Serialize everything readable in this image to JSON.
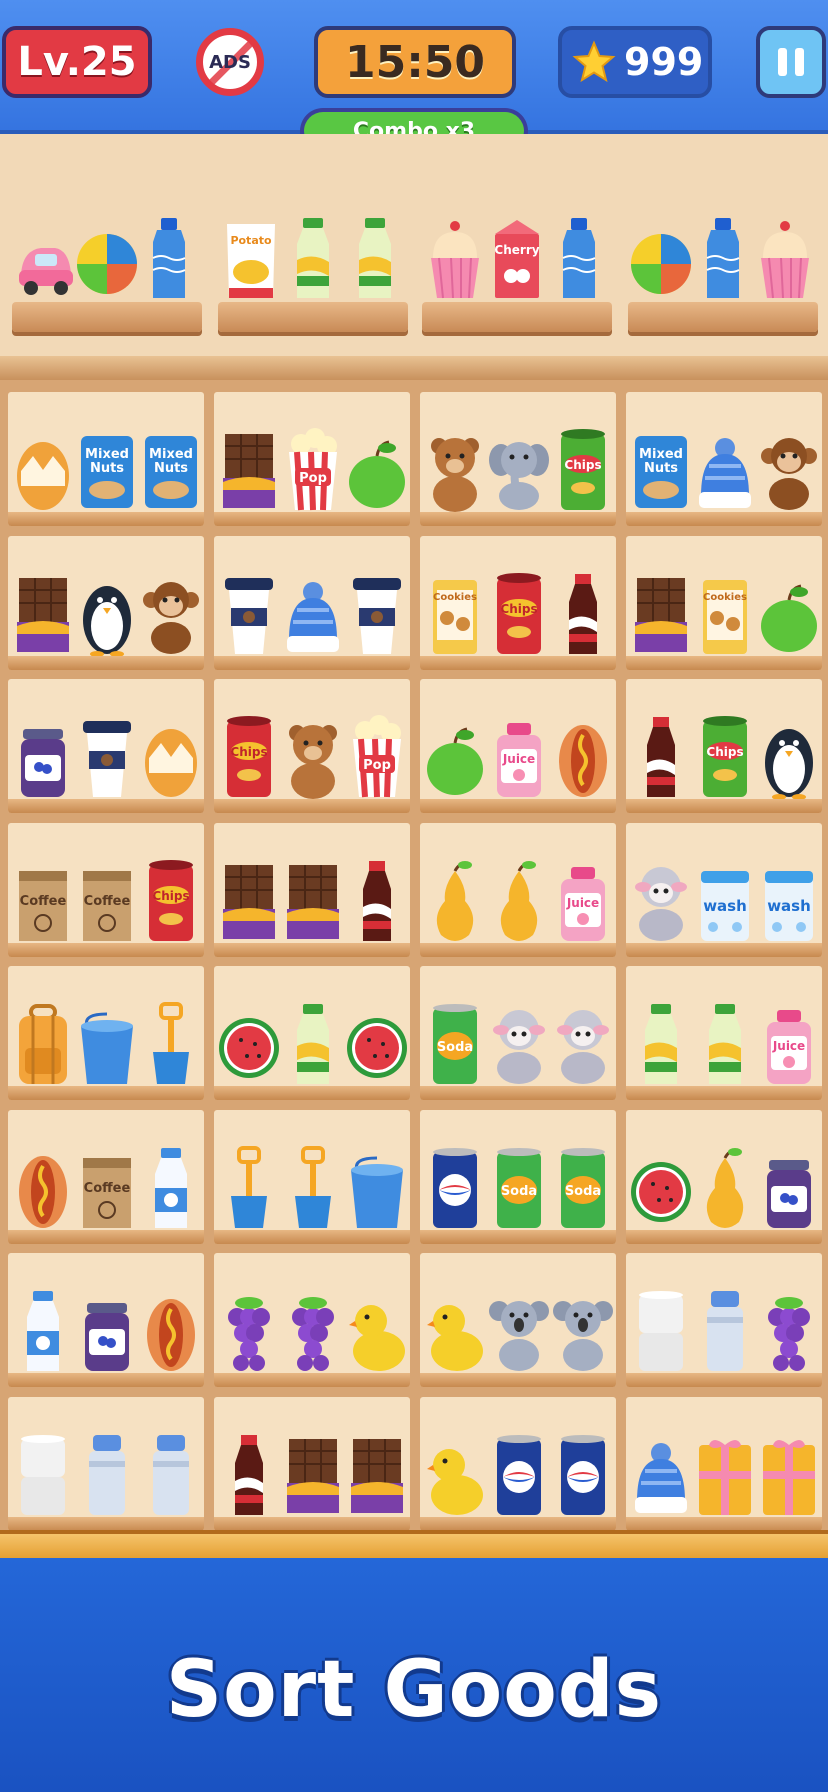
{
  "hud": {
    "level": "Lv.25",
    "ads": "ADS",
    "timer": "15:50",
    "stars": "999",
    "combo": "Combo x3"
  },
  "top_shelves": [
    [
      "car-icon",
      "beach-ball-icon",
      "water-bottle-icon"
    ],
    [
      "potato-chips-bag-icon",
      "juice-bottle-icon",
      "juice-bottle-icon"
    ],
    [
      "cupcake-icon",
      "cherry-carton-icon",
      "water-bottle-icon"
    ],
    [
      "beach-ball-icon",
      "water-bottle-icon",
      "cupcake-icon"
    ]
  ],
  "grid": [
    [
      [
        "egg-icon",
        "mixed-nuts-icon",
        "mixed-nuts-icon"
      ],
      [
        "chocolate-bar-icon",
        "popcorn-icon",
        "green-apple-icon"
      ],
      [
        "teddy-bear-icon",
        "elephant-icon",
        "chips-can-green-icon"
      ],
      [
        "mixed-nuts-icon",
        "beanie-hat-icon",
        "monkey-icon"
      ]
    ],
    [
      [
        "chocolate-bar-icon",
        "penguin-icon",
        "monkey-icon"
      ],
      [
        "coffee-cup-icon",
        "beanie-hat-icon",
        "coffee-cup-icon"
      ],
      [
        "cookies-box-icon",
        "chips-can-red-icon",
        "cola-bottle-icon"
      ],
      [
        "chocolate-bar-icon",
        "cookies-box-icon",
        "green-apple-icon"
      ]
    ],
    [
      [
        "jam-jar-icon",
        "coffee-cup-icon",
        "egg-icon"
      ],
      [
        "chips-can-red-icon",
        "teddy-bear-icon",
        "popcorn-icon"
      ],
      [
        "green-apple-icon",
        "juice-jug-icon",
        "hot-dog-icon"
      ],
      [
        "cola-bottle-icon",
        "chips-can-green-icon",
        "penguin-icon"
      ]
    ],
    [
      [
        "coffee-bag-icon",
        "coffee-bag-icon",
        "chips-can-red-icon"
      ],
      [
        "chocolate-bar-icon",
        "chocolate-bar-icon",
        "cola-bottle-icon"
      ],
      [
        "pear-icon",
        "pear-icon",
        "juice-jug-icon"
      ],
      [
        "sheep-icon",
        "detergent-icon",
        "detergent-icon"
      ]
    ],
    [
      [
        "backpack-icon",
        "bucket-icon",
        "shovel-icon"
      ],
      [
        "watermelon-icon",
        "juice-bottle-icon",
        "watermelon-icon"
      ],
      [
        "soda-can-icon",
        "sheep-icon",
        "sheep-icon"
      ],
      [
        "juice-bottle-icon",
        "juice-bottle-icon",
        "juice-jug-icon"
      ]
    ],
    [
      [
        "hot-dog-icon",
        "coffee-bag-icon",
        "milk-bottle-icon"
      ],
      [
        "shovel-icon",
        "shovel-icon",
        "bucket-icon"
      ],
      [
        "pepsi-can-icon",
        "soda-can-icon",
        "soda-can-icon"
      ],
      [
        "watermelon-icon",
        "pear-icon",
        "jam-jar-icon"
      ]
    ],
    [
      [
        "milk-bottle-icon",
        "jam-jar-icon",
        "hot-dog-icon"
      ],
      [
        "grapes-icon",
        "grapes-icon",
        "rubber-duck-icon"
      ],
      [
        "rubber-duck-icon",
        "koala-icon",
        "koala-icon"
      ],
      [
        "toilet-paper-icon",
        "thermos-icon",
        "grapes-icon"
      ]
    ],
    [
      [
        "toilet-paper-icon",
        "thermos-icon",
        "thermos-icon"
      ],
      [
        "cola-bottle-icon",
        "chocolate-bar-icon",
        "chocolate-bar-icon"
      ],
      [
        "rubber-duck-icon",
        "pepsi-can-icon",
        "pepsi-can-icon"
      ],
      [
        "beanie-hat-icon",
        "gift-box-icon",
        "gift-box-icon"
      ]
    ]
  ],
  "item_labels": {
    "potato": "Potato",
    "cherry": "Cherry",
    "mixed_nuts": "Mixed Nuts",
    "pop": "Pop",
    "chips": "Chips",
    "cookies": "Cookies",
    "juice": "Juice",
    "coffee": "Coffee",
    "wash": "wash",
    "soda": "Soda"
  },
  "banner_title": "Sort Goods",
  "colors": {
    "hud_bg": "#3f82ea",
    "level_red": "#e23a44",
    "timer_orange": "#f4a13b",
    "combo_green": "#59c743",
    "banner_blue": "#1f5fd0",
    "shelf_wood": "#d7a574"
  }
}
